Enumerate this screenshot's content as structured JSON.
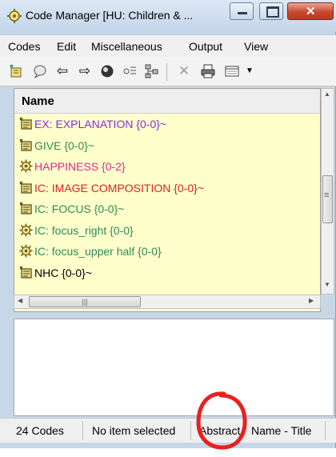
{
  "window": {
    "title": "Code Manager [HU: Children & ..."
  },
  "menu": [
    "Codes",
    "Edit",
    "Miscellaneous",
    "Output",
    "View"
  ],
  "toolbar_icons": [
    "new-code-icon",
    "comment-icon",
    "back-arrow-icon",
    "forward-arrow-icon",
    "network-icon",
    "code-options-icon",
    "tree-icon",
    "delete-icon",
    "print-icon",
    "view-options-icon"
  ],
  "list": {
    "column_header": "Name",
    "rows": [
      {
        "label": "EX:  EXPLANATION {0-0}~",
        "color": "#8a2be2"
      },
      {
        "label": "GIVE {0-0}~",
        "color": "#2e8b57"
      },
      {
        "label": "HAPPINESS {0-2}",
        "color": "#e0288a"
      },
      {
        "label": "IC:  IMAGE COMPOSITION {0-0}~",
        "color": "#e02020"
      },
      {
        "label": "IC: FOCUS {0-0}~",
        "color": "#2e8b57"
      },
      {
        "label": "IC: focus_right {0-0}",
        "color": "#2e8b57"
      },
      {
        "label": "IC: focus_upper half {0-0}",
        "color": "#2e8b57"
      },
      {
        "label": "NHC {0-0}~",
        "color": "#000000"
      }
    ]
  },
  "status": {
    "count": "24 Codes",
    "selection": "No item selected",
    "abstract": "Abstract",
    "name_title": "Name - Title"
  },
  "colors": {
    "list_background": "#ffffcc",
    "annotation_circle": "#e8201e"
  }
}
